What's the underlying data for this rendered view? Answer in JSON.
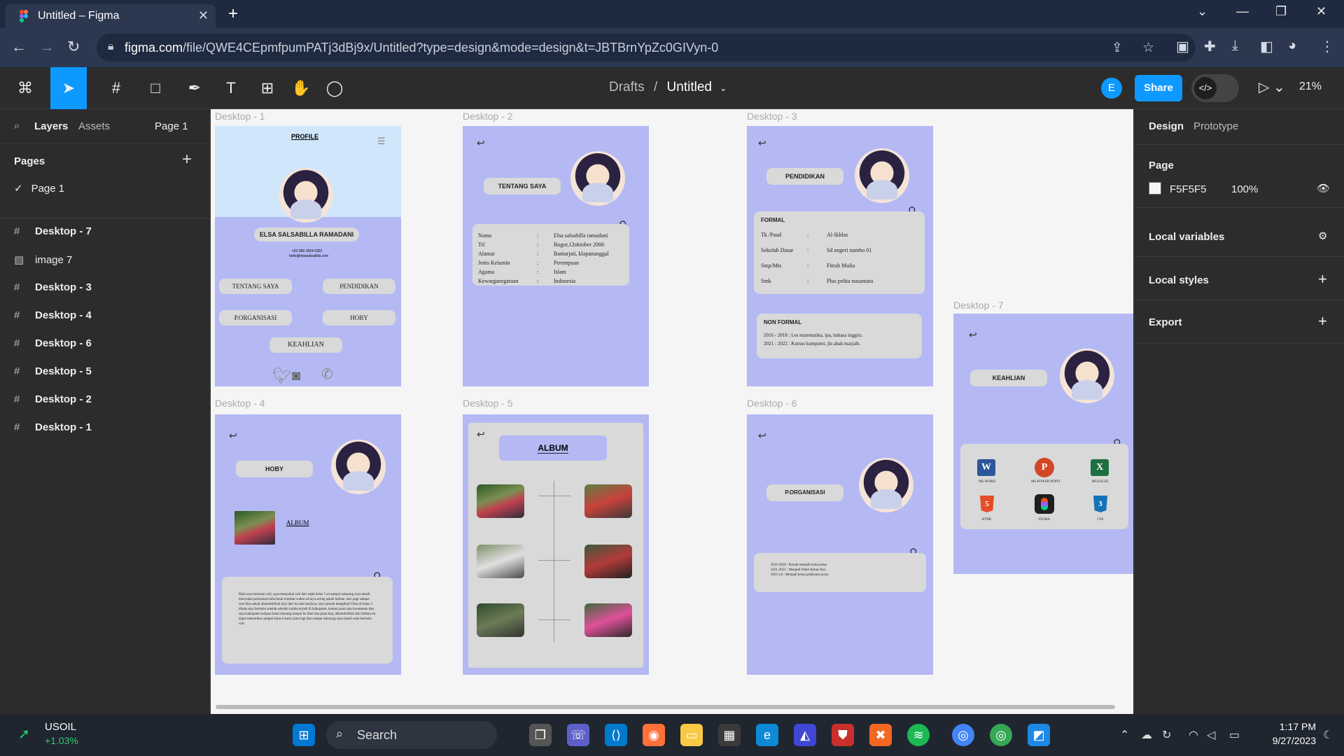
{
  "browser": {
    "tab_title": "Untitled – Figma",
    "url_host": "figma.com",
    "url_path": "/file/QWE4CEpmfpumPATj3dBj9x/Untitled?type=design&mode=design&t=JBTBrnYpZc0GIVyn-0"
  },
  "toolbar": {
    "breadcrumb_parent": "Drafts",
    "breadcrumb_sep": "/",
    "file_name": "Untitled",
    "avatar_initial": "E",
    "share_label": "Share",
    "zoom": "21%"
  },
  "left_panel": {
    "tab_layers": "Layers",
    "tab_assets": "Assets",
    "page_selector": "Page 1",
    "pages_heading": "Pages",
    "current_page": "Page 1",
    "layers": [
      "Desktop - 7",
      "image 7",
      "Desktop - 3",
      "Desktop - 4",
      "Desktop - 6",
      "Desktop - 5",
      "Desktop - 2",
      "Desktop - 1"
    ]
  },
  "right_panel": {
    "tab_design": "Design",
    "tab_prototype": "Prototype",
    "page_heading": "Page",
    "page_color": "F5F5F5",
    "page_opacity": "100%",
    "local_variables": "Local variables",
    "local_styles": "Local styles",
    "export": "Export"
  },
  "frames": {
    "d1": {
      "label": "Desktop - 1",
      "title": "PROFILE",
      "name": "ELSA SALSABILLA RAMADANI",
      "contact1": "+62 899 1824 6302",
      "contact2": "hello@elsasalsabilla.com",
      "btn1": "TENTANG SAYA",
      "btn2": "PENDIDIKAN",
      "btn3": "P.ORGANISASI",
      "btn4": "HOBY",
      "btn5": "KEAHLIAN"
    },
    "d2": {
      "label": "Desktop - 2",
      "title": "TENTANG SAYA",
      "rows": [
        {
          "k": "Nama",
          "v": "Elsa salsabilla ramadani"
        },
        {
          "k": "Ttl",
          "v": "Bogor,12oktober 2006"
        },
        {
          "k": "Alamat",
          "v": "Bantarjati, klapanunggal"
        },
        {
          "k": "Jenis Kelamin",
          "v": "Perempuan"
        },
        {
          "k": "Agama",
          "v": "Islam"
        },
        {
          "k": "Kewarganegaraan",
          "v": "Indonesia"
        }
      ]
    },
    "d3": {
      "label": "Desktop - 3",
      "title": "PENDIDIKAN",
      "formal_title": "FORMAL",
      "formal": [
        {
          "k": "Tk /Paud",
          "v": "Al-Ikhlas"
        },
        {
          "k": "Sekolah Dasar",
          "v": "Sd negeri nambo 01"
        },
        {
          "k": "Smp/Mts",
          "v": "Fitrah Mulia"
        },
        {
          "k": "Smk",
          "v": "Plus pelita nusantara"
        }
      ],
      "nonformal_title": "NON FORMAL",
      "nonformal1": "2016 - 2018 : Les matematika, ipa, bahasa inggris.",
      "nonformal2": "2021 - 2022 : Kursus komputer, jln abah marjaih."
    },
    "d4": {
      "label": "Desktop - 4",
      "title": "HOBY",
      "album_link": "ALBUM",
      "text": "Hobi saya bermain voli, saya menyukai voli dari sejak kelas 5 sd sampai sekarang saya masih menyukai permainan bola besar tersebut waktu sd saya sering sekali latihan. dari pagi sampai sore bisa sekali alhamdulillah niyo dari itu ada hasilnya, saya pernah mengikuti O2sn di kelas 5 dituta saya bermain setelah sekolah lomba terjadi di kabupaten, karena juara satu kecamatan dan saya kabupaten kalipan kami menang sampai ke final dan juara dua, alhamdulillah dari latihan itu dapat menembus sampai kelas 6 kami juara lagi dan sampai sekarang saya masih suka bermain voli."
    },
    "d5": {
      "label": "Desktop - 5",
      "title": "ALBUM"
    },
    "d6": {
      "label": "Desktop - 6",
      "title": "P.ORGANISASI",
      "line1": "2019-2020 : Pernah menjadi ketua kelas",
      "line2": "2021-2022 : Menjadi Wakil Ketua Osis",
      "line3": "2022 s/d  : Menjadi ketua pelaksana acara"
    },
    "d7": {
      "label": "Desktop - 7",
      "title": "KEAHLIAN",
      "skills": [
        "MS.WORD",
        "MS.POWER POINT",
        "MS.EXCEL",
        "HTML",
        "FIGMA",
        "CSS"
      ]
    }
  },
  "taskbar": {
    "ticker": "USOIL",
    "ticker_change": "+1.03%",
    "search": "Search",
    "time": "1:17 PM",
    "date": "9/27/2023"
  },
  "colors": {
    "frame_bg": "#b4b9f4",
    "accent": "#0d99ff",
    "canvas": "#f5f5f5"
  }
}
